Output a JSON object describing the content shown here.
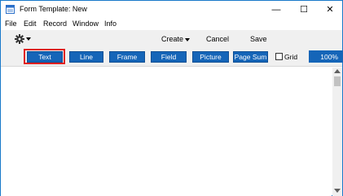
{
  "window": {
    "title": "Form Template: New",
    "icons": {
      "app": "form-app-icon",
      "minimize": "minimize-icon",
      "maximize": "maximize-icon",
      "close": "close-icon"
    },
    "controls": {
      "minimize": "—",
      "maximize": "☐",
      "close": "✕"
    }
  },
  "menubar": {
    "items": [
      "File",
      "Edit",
      "Record",
      "Window",
      "Info"
    ]
  },
  "toolbar": {
    "gear_icon": "gear-icon",
    "create_label": "Create",
    "cancel_label": "Cancel",
    "save_label": "Save"
  },
  "tools": {
    "items": [
      "Text",
      "Line",
      "Frame",
      "Field",
      "Picture",
      "Page Sum"
    ],
    "selected": "Text",
    "grid_label": "Grid",
    "grid_checked": false,
    "zoom": "100%"
  },
  "colors": {
    "button_blue": "#1565b8",
    "selection_red": "#e02020",
    "window_border": "#1979ca"
  }
}
